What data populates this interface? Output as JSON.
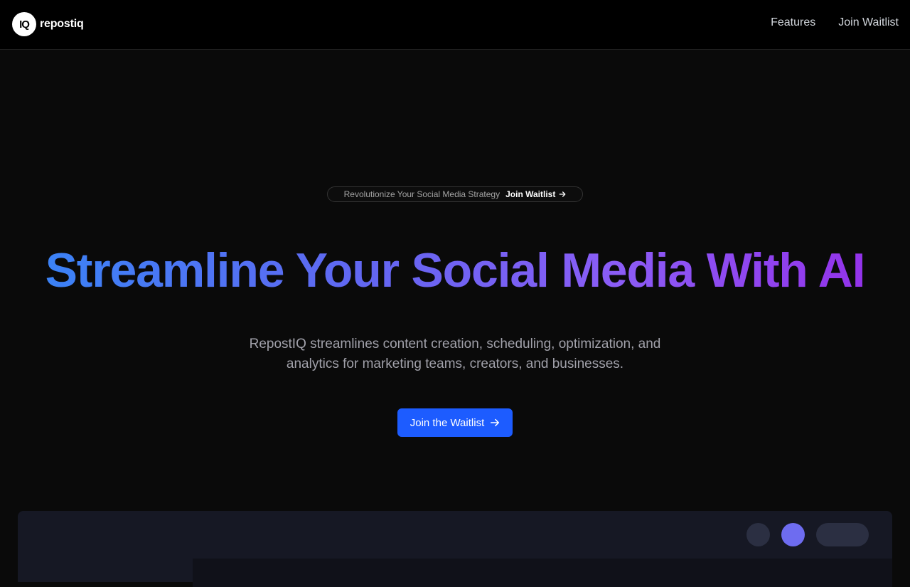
{
  "nav": {
    "logo_mark": "IQ",
    "logo_text": "repostiq",
    "links": [
      "Features",
      "Join Waitlist"
    ]
  },
  "hero": {
    "pill_text": "Revolutionize Your Social Media Strategy",
    "pill_link": "Join Waitlist",
    "headline": "Streamline Your Social Media With AI",
    "subline1": "RepostIQ streamlines content creation, scheduling, optimization, and",
    "subline2": "analytics for marketing teams, creators, and businesses.",
    "cta_label": "Join the Waitlist"
  },
  "icons": {
    "pill_arrow": "arrow-right-icon",
    "cta_arrow": "arrow-right-icon"
  },
  "colors": {
    "cta": "#1d5cff",
    "gradient_start": "#3b82f6",
    "gradient_end": "#9333ea"
  }
}
